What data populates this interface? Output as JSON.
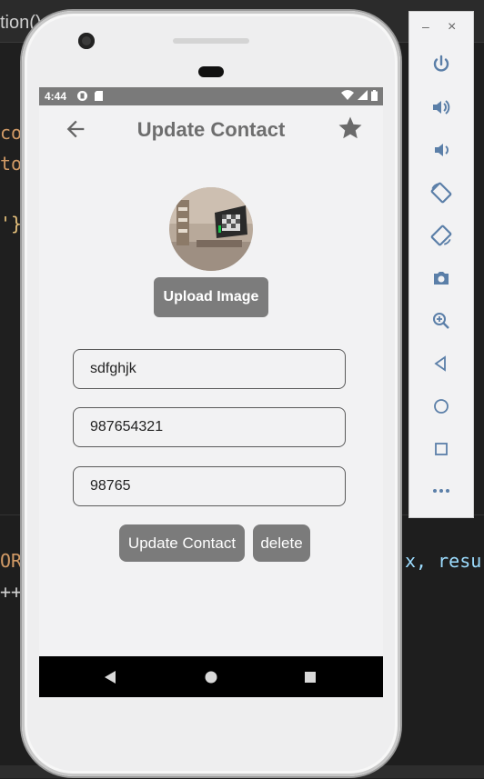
{
  "editor": {
    "tab_text": "tion()",
    "code_fragments": [
      "con",
      "tor",
      "'}",
      "ORI",
      "++",
      "x, resu"
    ]
  },
  "status_bar": {
    "time": "4:44"
  },
  "app_bar": {
    "title": "Update Contact"
  },
  "profile": {
    "upload_label": "Upload Image"
  },
  "form": {
    "name_value": "sdfghjk",
    "phone_value": "987654321",
    "third_value": "98765"
  },
  "actions": {
    "update_label": "Update Contact",
    "delete_label": "delete"
  },
  "emulator_toolbar": {
    "window_controls": [
      "–",
      "×"
    ],
    "icons": [
      "power-icon",
      "volume-up-icon",
      "volume-down-icon",
      "rotate-left-icon",
      "rotate-right-icon",
      "camera-icon",
      "zoom-icon",
      "back-icon",
      "home-icon",
      "overview-icon",
      "more-icon"
    ]
  },
  "colors": {
    "status_bar": "#7a7a7a",
    "button": "#7b7b7b",
    "screen_bg": "#f2f2f3",
    "title": "#6e6e6e"
  }
}
